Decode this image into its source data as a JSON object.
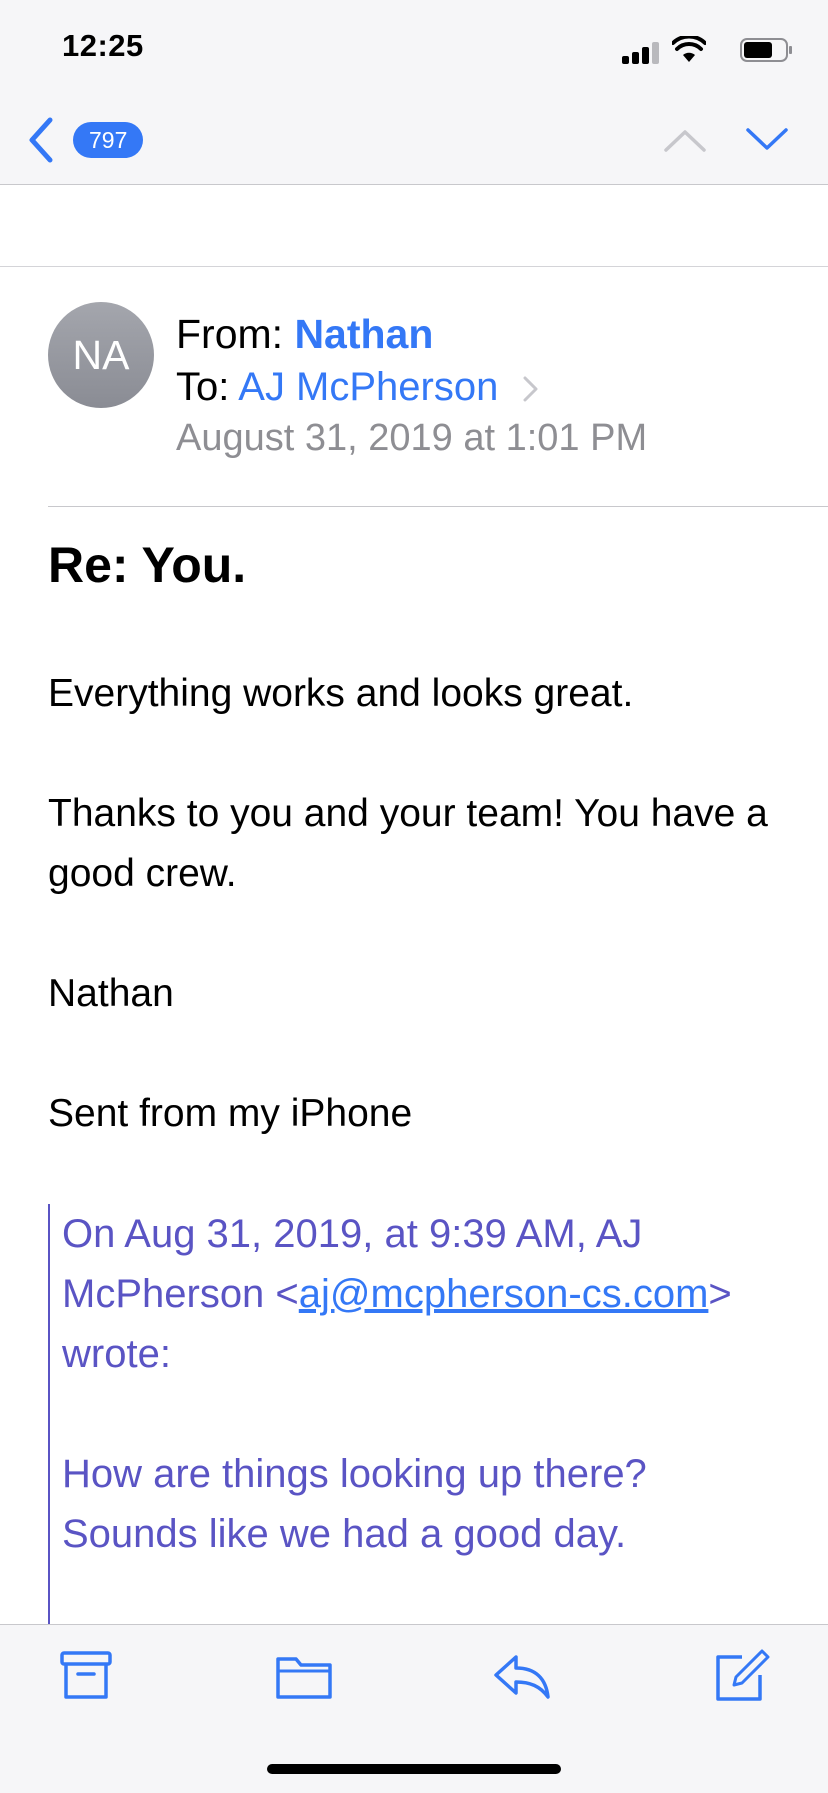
{
  "status_bar": {
    "time": "12:25",
    "battery_level": 0.7
  },
  "nav": {
    "unread_count": "797"
  },
  "message": {
    "avatar_initials": "NA",
    "from_label": "From:",
    "from_name": "Nathan",
    "to_label": "To:",
    "to_name": "AJ McPherson",
    "date": "August 31, 2019 at 1:01 PM",
    "subject": "Re: You.",
    "body": [
      "Everything works and looks great.",
      "Thanks to you and your team! You have a good crew.",
      "Nathan",
      "Sent from my iPhone"
    ],
    "quoted": {
      "intro_before": "On Aug 31, 2019, at 9:39 AM, AJ McPherson <",
      "email_link": "aj@mcpherson-cs.com",
      "intro_after": "> wrote:",
      "body": "How are things looking up there? Sounds like we had a good day."
    }
  },
  "toolbar": {
    "icons": [
      "archive-icon",
      "folder-icon",
      "reply-icon",
      "compose-icon"
    ]
  },
  "colors": {
    "accent": "#3478f6",
    "quote": "#5a54c4",
    "secondary_text": "#8e8e93",
    "bar_background": "#f6f6f8"
  }
}
